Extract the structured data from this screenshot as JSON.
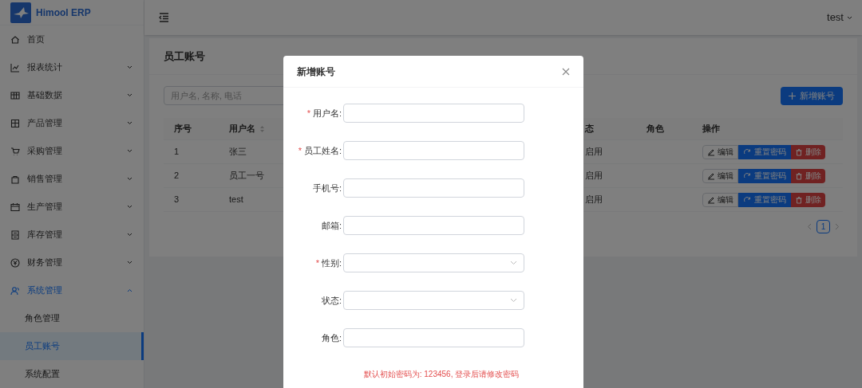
{
  "header": {
    "brand": "Himool ERP",
    "user": "test"
  },
  "sidebar": {
    "items": [
      {
        "label": "首页"
      },
      {
        "label": "报表统计",
        "expanded": false
      },
      {
        "label": "基础数据",
        "expanded": false
      },
      {
        "label": "产品管理",
        "expanded": false
      },
      {
        "label": "采购管理",
        "expanded": false
      },
      {
        "label": "销售管理",
        "expanded": false
      },
      {
        "label": "生产管理",
        "expanded": false
      },
      {
        "label": "库存管理",
        "expanded": false
      },
      {
        "label": "财务管理",
        "expanded": false
      },
      {
        "label": "系统管理",
        "expanded": true,
        "children": [
          {
            "label": "角色管理",
            "selected": false
          },
          {
            "label": "员工账号",
            "selected": true
          },
          {
            "label": "系统配置",
            "selected": false
          }
        ]
      }
    ]
  },
  "page": {
    "title": "员工账号",
    "search": {
      "placeholder": "用户名, 名称, 电话"
    },
    "add_button": "新增账号",
    "table": {
      "columns": [
        {
          "label": "序号"
        },
        {
          "label": "用户名",
          "sortable": true
        },
        {
          "label": "态"
        },
        {
          "label": "角色"
        },
        {
          "label": "操作"
        }
      ],
      "rows": [
        {
          "index": "1",
          "username": "张三",
          "status": "启用",
          "actions": [
            "编辑",
            "重置密码",
            "删除"
          ]
        },
        {
          "index": "2",
          "username": "员工一号",
          "status": "启用",
          "actions": [
            "编辑",
            "重置密码",
            "删除"
          ]
        },
        {
          "index": "3",
          "username": "test",
          "status": "启用",
          "actions": [
            "编辑",
            "重置密码",
            "删除"
          ]
        }
      ]
    },
    "pagination": {
      "pages": [
        {
          "label": "1",
          "selected": true
        }
      ]
    }
  },
  "modal": {
    "title": "新增账号",
    "required_mark": "*",
    "fields": [
      {
        "label": "用户名:",
        "required": true,
        "kind": "input"
      },
      {
        "label": "员工姓名:",
        "required": true,
        "kind": "input"
      },
      {
        "label": "手机号:",
        "required": false,
        "kind": "input"
      },
      {
        "label": "邮箱:",
        "required": false,
        "kind": "input"
      },
      {
        "label": "性别:",
        "required": true,
        "kind": "select"
      },
      {
        "label": "状态:",
        "required": false,
        "kind": "select"
      },
      {
        "label": "角色:",
        "required": false,
        "kind": "input"
      }
    ],
    "note": "默认初始密码为: 123456, 登录后请修改密码"
  }
}
